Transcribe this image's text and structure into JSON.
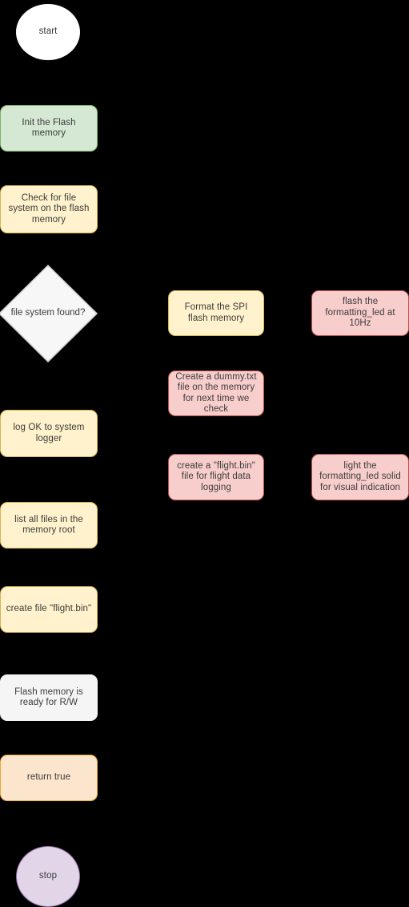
{
  "diagram": {
    "title": "Flash memory init flowchart",
    "background": "#000000",
    "palette": {
      "green_fill": "#d5e8d4",
      "green_stroke": "#82b366",
      "yellow_fill": "#fff2cc",
      "yellow_stroke": "#d6b656",
      "pink_fill": "#f8cecc",
      "pink_stroke": "#b85450",
      "peach_fill": "#fce5cd",
      "peach_stroke": "#e8a93b",
      "gray_fill": "#f5f5f5",
      "white_fill": "#ffffff",
      "purple_fill": "#e1d5e7",
      "purple_stroke": "#9673a6",
      "text": "#3b3b3b"
    },
    "nodes": {
      "start": {
        "label": "start",
        "shape": "circle",
        "style": "white"
      },
      "init_flash": {
        "label": "Init the Flash memory",
        "shape": "rounded-rect",
        "style": "green"
      },
      "check_fs": {
        "label": "Check for file system on the flash memory",
        "shape": "rounded-rect",
        "style": "yellow"
      },
      "fs_found": {
        "label": "file system found?",
        "shape": "diamond",
        "style": "white"
      },
      "log_ok": {
        "label": "log OK to system logger",
        "shape": "rounded-rect",
        "style": "yellow"
      },
      "list_files": {
        "label": "list all files in the memory root",
        "shape": "rounded-rect",
        "style": "yellow"
      },
      "create_flight_bin": {
        "label": "create file \"flight.bin\"",
        "shape": "rounded-rect",
        "style": "yellow"
      },
      "ready_rw": {
        "label": "Flash memory is ready for R/W",
        "shape": "rounded-rect",
        "style": "gray"
      },
      "return_true": {
        "label": "return true",
        "shape": "rounded-rect",
        "style": "peach"
      },
      "stop": {
        "label": "stop",
        "shape": "circle",
        "style": "purple"
      },
      "format_spi": {
        "label": "Format the SPI flash memory",
        "shape": "rounded-rect",
        "style": "yellow"
      },
      "create_dummy": {
        "label": "Create a dummy.txt file on the memory for next time we check",
        "shape": "rounded-rect",
        "style": "pink"
      },
      "create_flight_log": {
        "label": "create a \"flight.bin\" file for flight data logging",
        "shape": "rounded-rect",
        "style": "pink"
      },
      "flash_led": {
        "label": "flash the formatting_led at 10Hz",
        "shape": "rounded-rect",
        "style": "pink"
      },
      "light_led": {
        "label": "light the formatting_led solid for visual indication",
        "shape": "rounded-rect",
        "style": "pink"
      }
    }
  }
}
